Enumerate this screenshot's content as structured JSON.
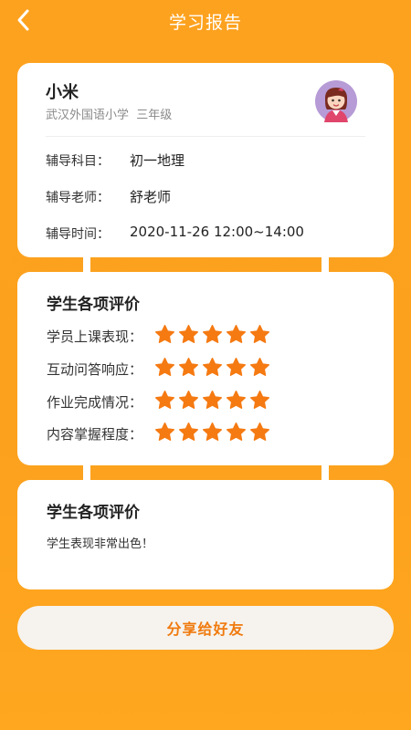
{
  "header": {
    "title": "学习报告"
  },
  "profile": {
    "name": "小米",
    "school": "武汉外国语小学",
    "grade": "三年级",
    "rows": [
      {
        "label": "辅导科目：",
        "value": "初一地理"
      },
      {
        "label": "辅导老师：",
        "value": "舒老师"
      },
      {
        "label": "辅导时间：",
        "value": "2020-11-26 12:00~14:00"
      }
    ]
  },
  "evaluation": {
    "title": "学生各项评价",
    "items": [
      {
        "label": "学员上课表现：",
        "stars": 5
      },
      {
        "label": "互动问答响应：",
        "stars": 5
      },
      {
        "label": "作业完成情况：",
        "stars": 5
      },
      {
        "label": "内容掌握程度：",
        "stars": 5
      }
    ]
  },
  "comment_card": {
    "title": "学生各项评价",
    "text": "学生表现非常出色！"
  },
  "share_button": {
    "label": "分享给好友"
  },
  "colors": {
    "accent": "#F07A0E",
    "star": "#F57A12",
    "background": "#FDA21F"
  }
}
